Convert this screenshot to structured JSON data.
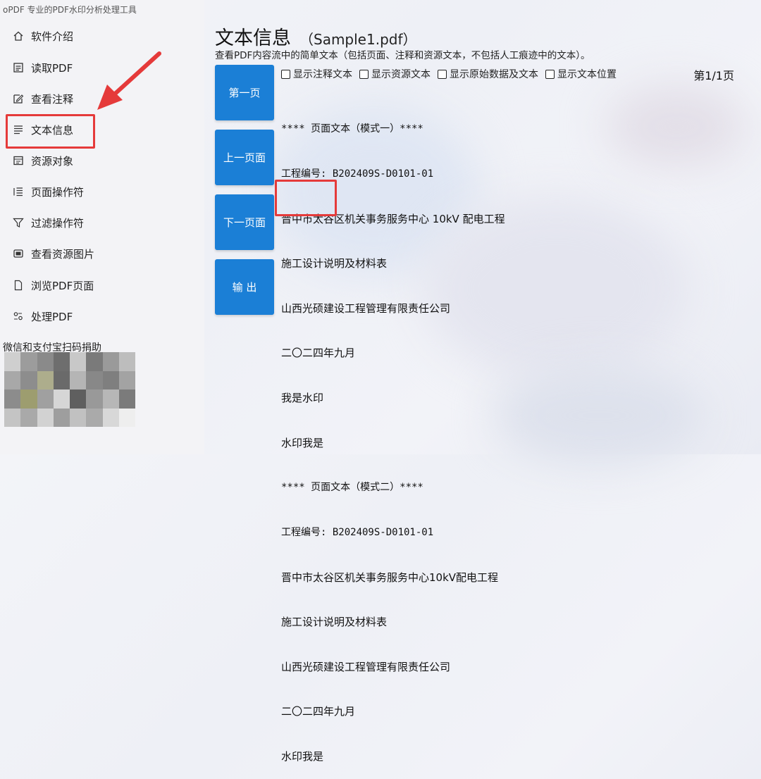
{
  "app": {
    "title": "oPDF 专业的PDF水印分析处理工具"
  },
  "sidebar": {
    "items": [
      {
        "label": "软件介绍",
        "icon": "home-icon"
      },
      {
        "label": "读取PDF",
        "icon": "document-icon"
      },
      {
        "label": "查看注释",
        "icon": "annotation-icon"
      },
      {
        "label": "文本信息",
        "icon": "text-lines-icon"
      },
      {
        "label": "资源对象",
        "icon": "resource-icon"
      },
      {
        "label": "页面操作符",
        "icon": "list-icon"
      },
      {
        "label": "过滤操作符",
        "icon": "filter-icon"
      },
      {
        "label": "查看资源图片",
        "icon": "image-icon"
      },
      {
        "label": "浏览PDF页面",
        "icon": "page-icon"
      },
      {
        "label": "处理PDF",
        "icon": "process-icon"
      }
    ],
    "donate_label": "微信和支付宝扫码捐助"
  },
  "main": {
    "title": "文本信息",
    "file": "（Sample1.pdf）",
    "subtitle": "查看PDF内容流中的简单文本（包括页面、注释和资源文本，不包括人工痕迹中的文本）。",
    "buttons": {
      "first": "第一页",
      "prev": "上一页面",
      "next": "下一页面",
      "export": "输 出"
    },
    "options": [
      {
        "label": "显示注释文本",
        "checked": false
      },
      {
        "label": "显示资源文本",
        "checked": false
      },
      {
        "label": "显示原始数据及文本",
        "checked": false
      },
      {
        "label": "显示文本位置",
        "checked": false
      }
    ],
    "page_indicator": "第1/1页",
    "lines": [
      "**** 页面文本（模式一）****",
      "工程编号: B202409S-D0101-01",
      "晋中市太谷区机关事务服务中心 10kV 配电工程",
      "施工设计说明及材料表",
      "山西光硕建设工程管理有限责任公司",
      "二〇二四年九月",
      "我是水印",
      "水印我是",
      "**** 页面文本（模式二）****",
      "工程编号: B202409S-D0101-01",
      "晋中市太谷区机关事务服务中心10kV配电工程",
      "施工设计说明及材料表",
      "山西光硕建设工程管理有限责任公司",
      "二〇二四年九月",
      "水印我是"
    ]
  },
  "colors": {
    "accent": "#1b7fd6",
    "highlight": "#e53a3a"
  }
}
